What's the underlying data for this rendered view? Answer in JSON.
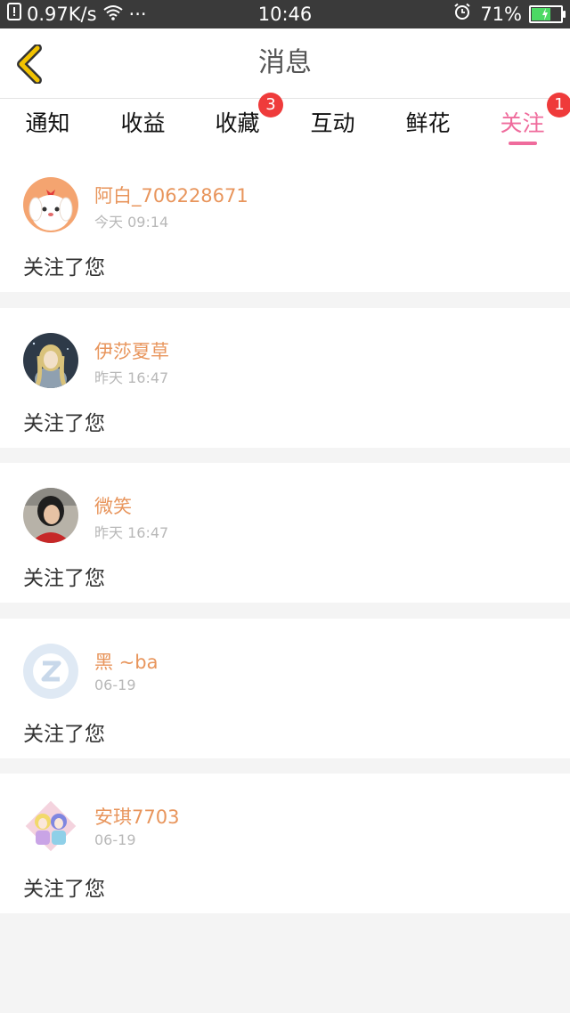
{
  "status_bar": {
    "network_speed": "0.97K/s",
    "dots": "···",
    "time": "10:46",
    "battery_percent": "71%",
    "battery_level": 0.71
  },
  "header": {
    "title": "消息",
    "back_icon": "chevron-left-icon",
    "accent_color": "#f2c300"
  },
  "tabs": [
    {
      "label": "通知",
      "badge": ""
    },
    {
      "label": "收益",
      "badge": ""
    },
    {
      "label": "收藏",
      "badge": "3"
    },
    {
      "label": "互动",
      "badge": ""
    },
    {
      "label": "鲜花",
      "badge": ""
    },
    {
      "label": "关注",
      "badge": "1",
      "active": true
    }
  ],
  "colors": {
    "active_tab": "#ef6b9c",
    "username": "#e8955c",
    "badge": "#ef3b3b"
  },
  "messages": [
    {
      "name": "阿白_706228671",
      "time": "今天 09:14",
      "text": "关注了您",
      "avatar": "puppy-avatar"
    },
    {
      "name": "伊莎夏草",
      "time": "昨天 16:47",
      "text": "关注了您",
      "avatar": "anime-girl-avatar"
    },
    {
      "name": "微笑",
      "time": "昨天 16:47",
      "text": "关注了您",
      "avatar": "photo-avatar"
    },
    {
      "name": "黑 ~ba",
      "time": "06-19",
      "text": "关注了您",
      "avatar": "default-z-avatar"
    },
    {
      "name": "安琪7703",
      "time": "06-19",
      "text": "关注了您",
      "avatar": "anime-pair-avatar"
    }
  ]
}
